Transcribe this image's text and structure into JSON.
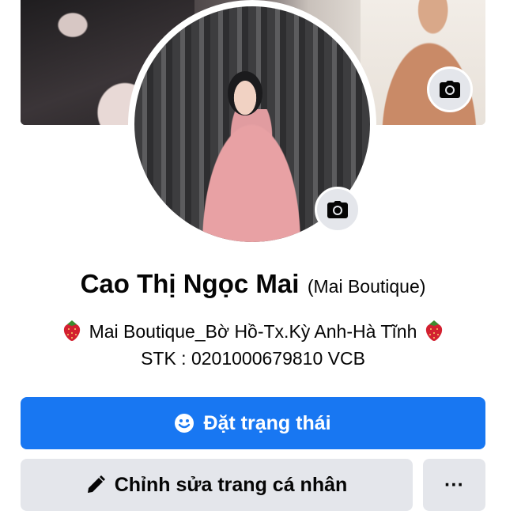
{
  "profile": {
    "name": "Cao Thị Ngọc Mai",
    "alternate_name": "(Mai Boutique)",
    "bio_line1": "Mai Boutique_Bờ Hồ-Tx.Kỳ Anh-Hà Tĩnh",
    "bio_line2": "STK : 0201000679810 VCB"
  },
  "actions": {
    "status_label": "Đặt trạng thái",
    "edit_label": "Chỉnh sửa trang cá nhân",
    "more_label": "···"
  },
  "icons": {
    "cover_camera": "camera-icon",
    "avatar_camera": "camera-icon",
    "status": "smiley-icon",
    "edit": "pencil-icon",
    "bio_emoji": "strawberry-icon"
  },
  "colors": {
    "primary": "#1877f2",
    "secondary_button": "#e4e6eb",
    "text": "#050505"
  }
}
